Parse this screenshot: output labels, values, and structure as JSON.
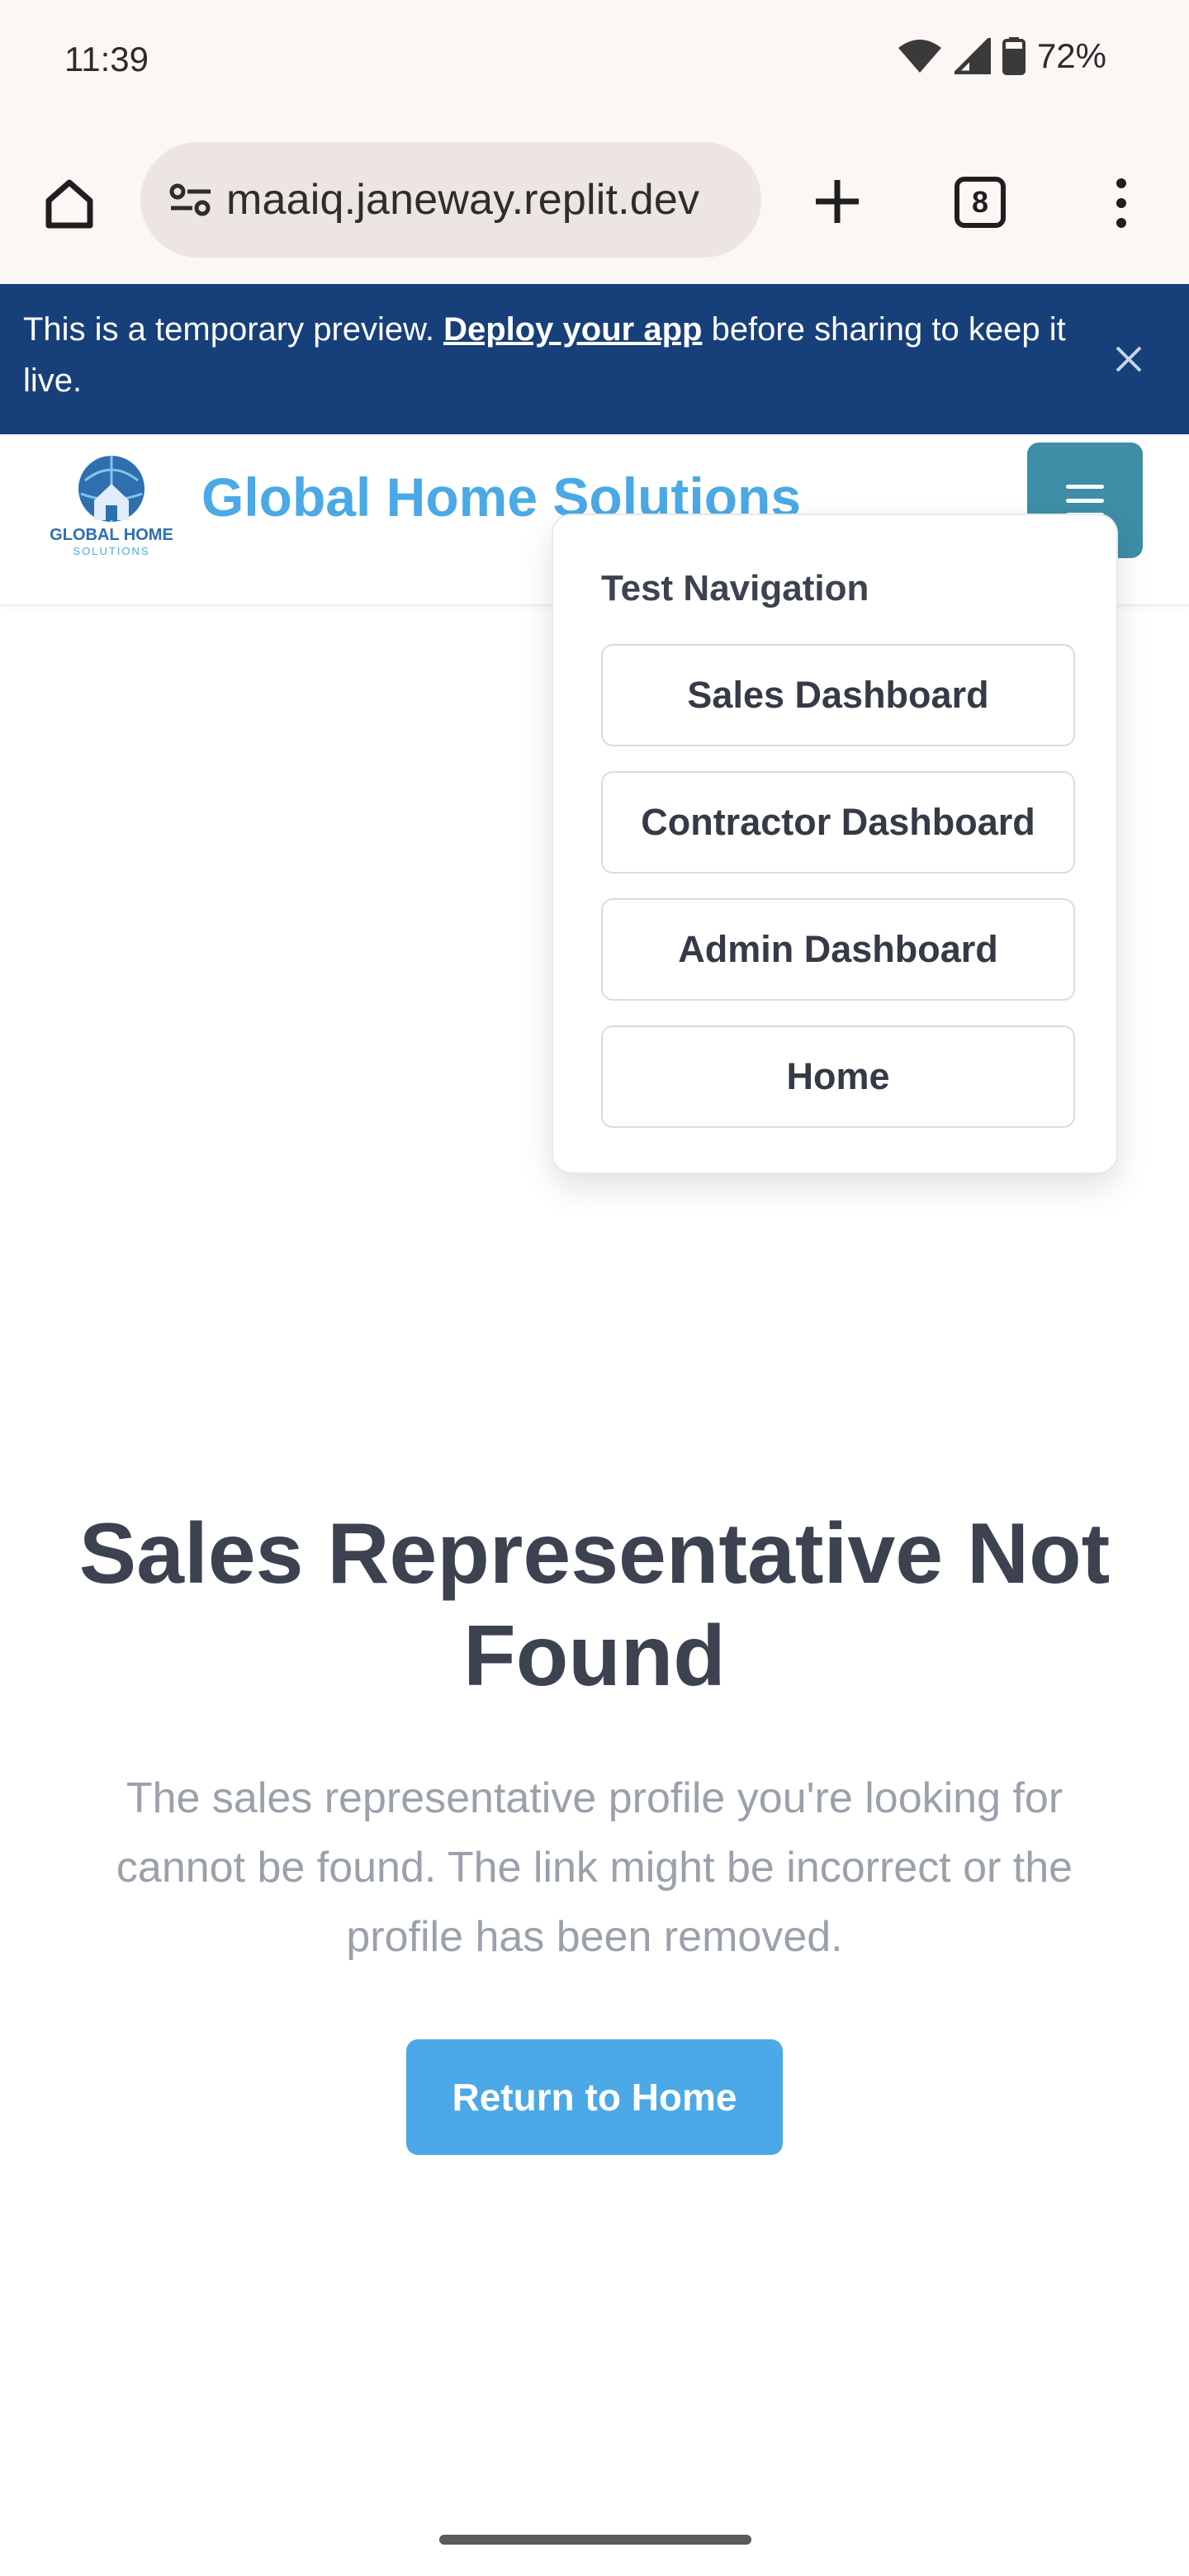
{
  "status_bar": {
    "time": "11:39",
    "battery_percent": "72%",
    "icons": [
      "wifi-icon",
      "signal-icon",
      "battery-icon"
    ]
  },
  "browser": {
    "url": "maaiq.janeway.replit.dev",
    "tab_count": "8",
    "icons": [
      "home-icon",
      "site-settings-icon",
      "new-tab-icon",
      "tab-switcher-icon",
      "more-options-icon"
    ]
  },
  "banner": {
    "text_before": "This is a temporary preview. ",
    "link": "Deploy your app",
    "text_after": " before sharing to keep it live.",
    "background": "#173f7a"
  },
  "header": {
    "brand": "Global Home Solutions",
    "logo_text_main": "GLOBAL HOME",
    "logo_text_sub": "SOLUTIONS",
    "brand_color": "#4aa9e6",
    "menu_button_color": "#3d8ea6"
  },
  "dropdown": {
    "title": "Test Navigation",
    "items": [
      {
        "label": "Sales Dashboard"
      },
      {
        "label": "Contractor Dashboard"
      },
      {
        "label": "Admin Dashboard"
      },
      {
        "label": "Home"
      }
    ]
  },
  "main": {
    "title": "Sales Representative Not Found",
    "description": "The sales representative profile you're looking for cannot be found. The link might be incorrect or the profile has been removed.",
    "button_label": "Return to Home",
    "button_color": "#4aa9e6"
  }
}
